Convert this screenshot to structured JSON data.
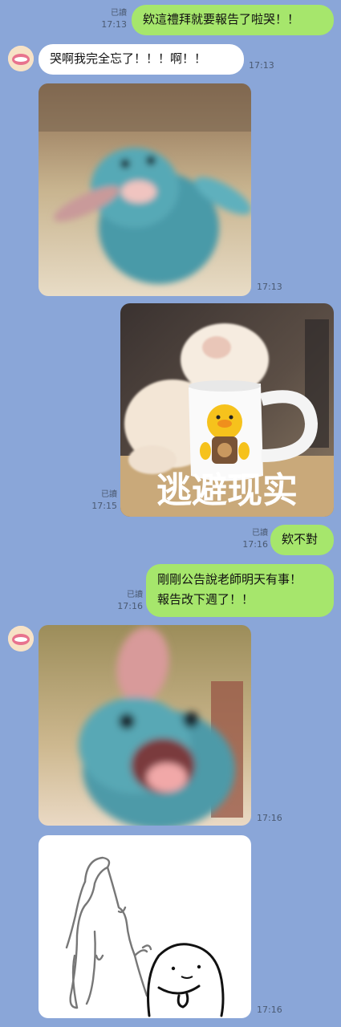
{
  "messages": [
    {
      "side": "out",
      "text": "欸這禮拜就要報告了啦哭！！",
      "read": "已讀",
      "time": "17:13"
    },
    {
      "side": "in",
      "text": "哭啊我完全忘了！！！啊！！",
      "time": "17:13"
    },
    {
      "side": "in",
      "type": "image",
      "desc": "blue-creature-screaming",
      "time": "17:13"
    },
    {
      "side": "out",
      "type": "image",
      "caption": "逃避现实",
      "read": "已讀",
      "time": "17:15"
    },
    {
      "side": "out",
      "text": "欸不對",
      "read": "已讀",
      "time": "17:16"
    },
    {
      "side": "out",
      "text_line1": "剛剛公告說老師明天有事！",
      "text_line2": "報告改下週了！！",
      "read": "已讀",
      "time": "17:16"
    },
    {
      "side": "in",
      "type": "image",
      "desc": "blue-creature-laughing",
      "time": "17:16"
    },
    {
      "side": "in",
      "type": "image",
      "desc": "doodle-sticker",
      "time": "17:16"
    }
  ],
  "colors": {
    "background": "#8aa6d8",
    "outgoing_bubble": "#a6e66c",
    "incoming_bubble": "#ffffff"
  }
}
